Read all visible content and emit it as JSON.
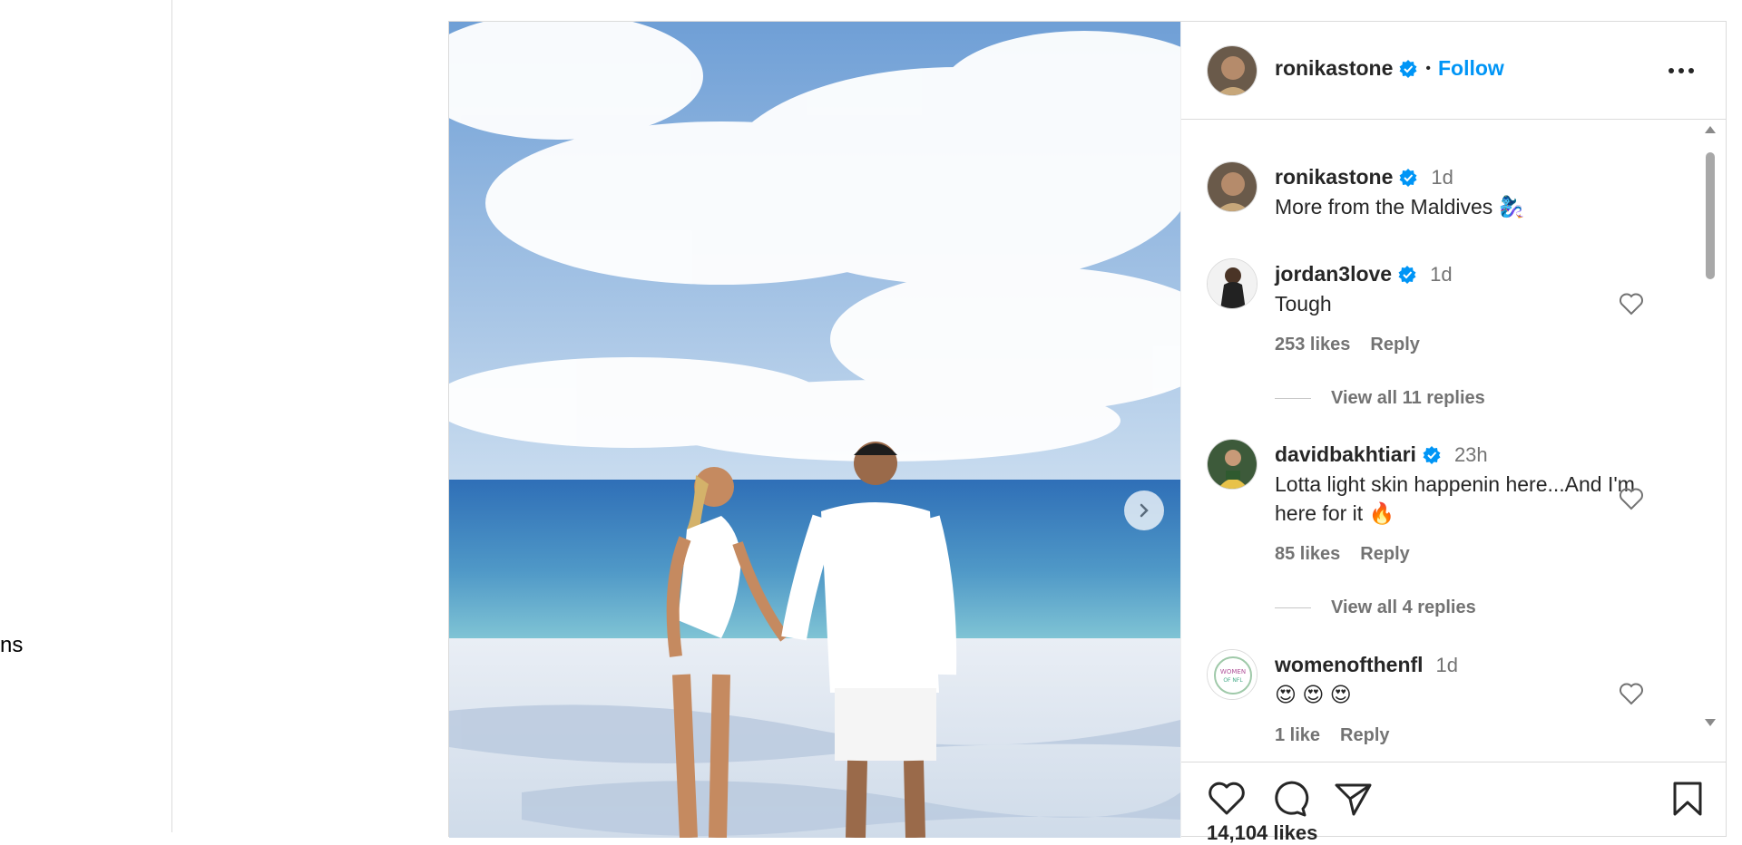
{
  "sidebar": {
    "partial_text": "ns"
  },
  "post": {
    "author": "ronikastone",
    "follow_label": "Follow",
    "separator": "•",
    "caption": {
      "username": "ronikastone",
      "time": "1d",
      "text": "More from the Maldives 🧞‍♀️"
    },
    "comments": [
      {
        "username": "jordan3love",
        "time": "1d",
        "text": "Tough",
        "likes": "253 likes",
        "reply_label": "Reply",
        "view_replies": "View all 11 replies"
      },
      {
        "username": "davidbakhtiari",
        "time": "23h",
        "text": "Lotta light skin happenin here...And I'm here for it 🔥",
        "likes": "85 likes",
        "reply_label": "Reply",
        "view_replies": "View all 4 replies"
      },
      {
        "username": "womenofthenfl",
        "time": "1d",
        "text": "😍 😍 😍",
        "likes": "1 like",
        "reply_label": "Reply"
      }
    ],
    "like_count": "14,104 likes"
  },
  "icons": {
    "more": "more-horizontal-icon",
    "verified": "verified-badge-icon",
    "like": "heart-icon",
    "comment": "comment-icon",
    "share": "paper-plane-icon",
    "save": "bookmark-icon",
    "next": "chevron-right-icon"
  },
  "colors": {
    "accent": "#0095f6",
    "verified": "#0095f6",
    "muted": "#737373",
    "text": "#262626",
    "border": "#dbdbdb"
  }
}
